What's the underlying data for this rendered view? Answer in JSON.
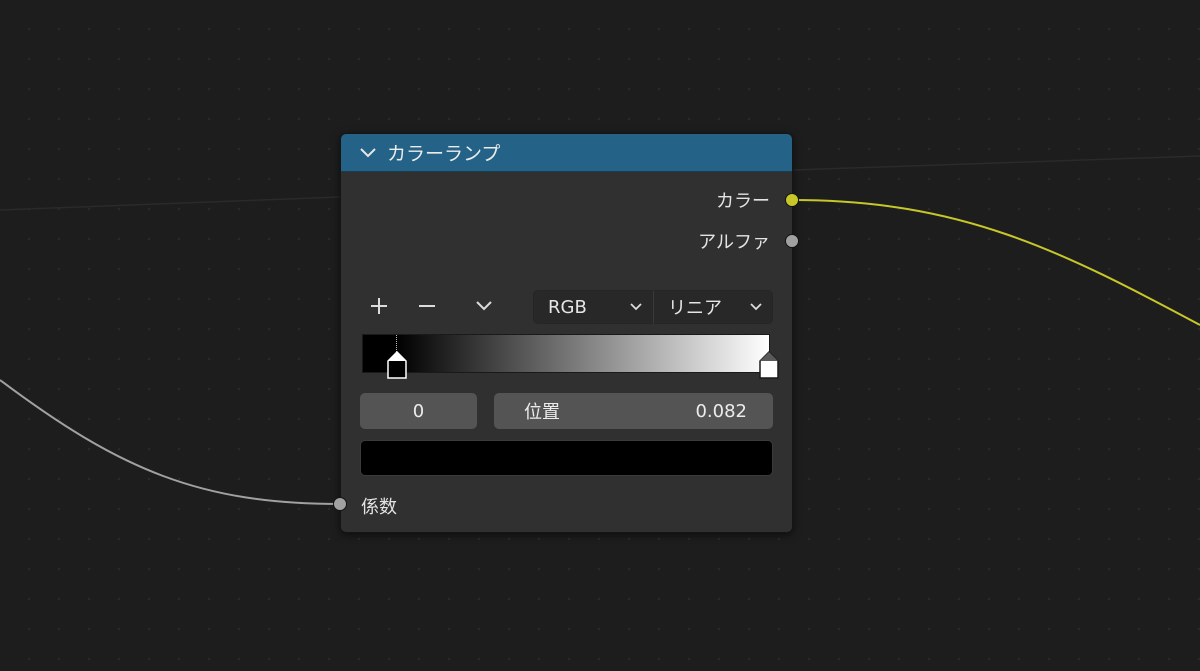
{
  "node": {
    "title": "カラーランプ",
    "outputs": [
      {
        "label": "カラー",
        "socket_color": "#c7c729"
      },
      {
        "label": "アルファ",
        "socket_color": "#a1a1a1"
      }
    ],
    "toolbar": {
      "add_icon": "plus-icon",
      "remove_icon": "minus-icon",
      "menu_icon": "chevron-down-icon"
    },
    "color_mode": "RGB",
    "interpolation": "リニア",
    "color_ramp": {
      "stops": [
        {
          "position": 0.082,
          "color": "#000000",
          "active": true
        },
        {
          "position": 1.0,
          "color": "#ffffff",
          "active": false
        }
      ]
    },
    "active_index": "0",
    "position_label": "位置",
    "position_value": "0.082",
    "active_color": "#000000",
    "input": {
      "label": "係数",
      "socket_color": "#a1a1a1"
    }
  },
  "colors": {
    "header": "#246287",
    "node_body": "#303030",
    "color_wire": "#c7c729",
    "gray_wire": "#a1a1a1"
  }
}
